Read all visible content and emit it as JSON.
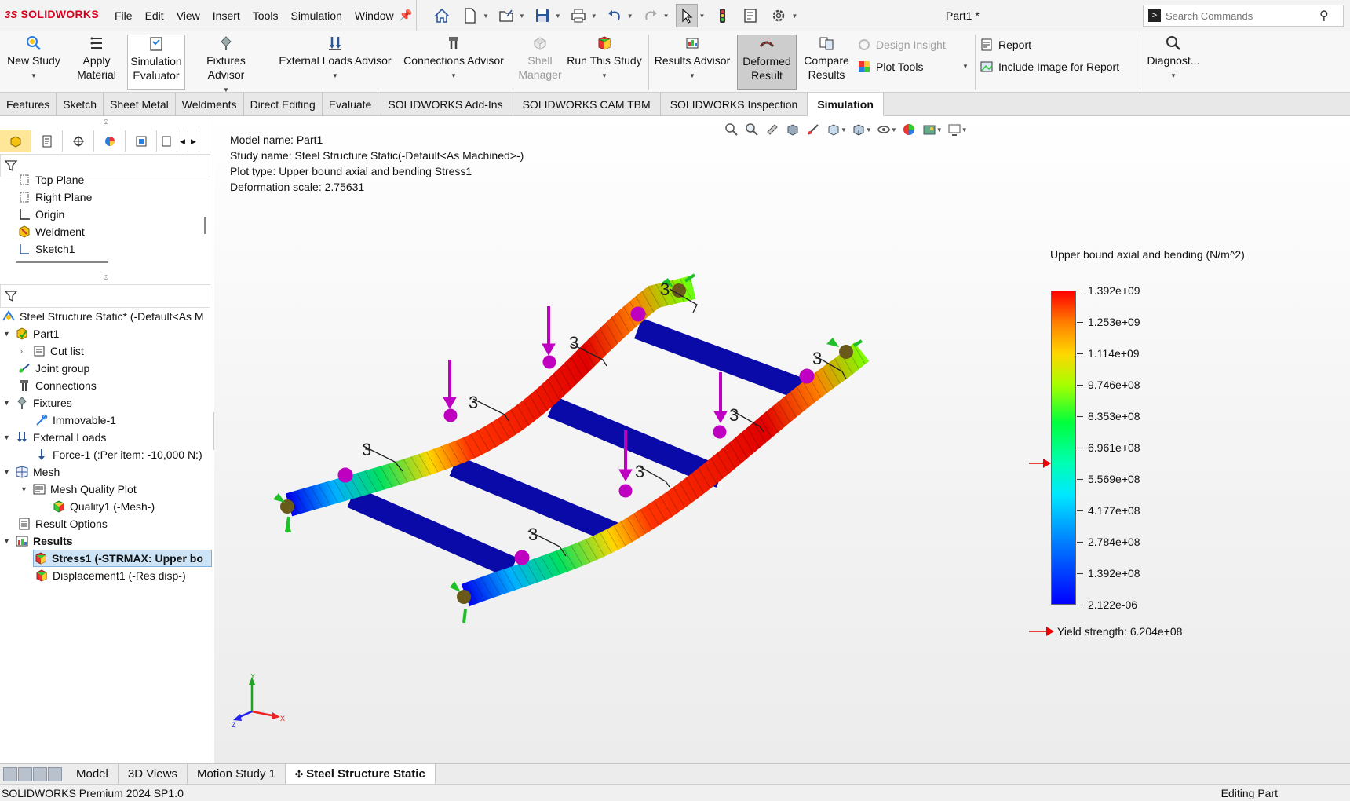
{
  "app": {
    "logo": "SOLIDWORKS",
    "doc_title": "Part1 *"
  },
  "menus": [
    "File",
    "Edit",
    "View",
    "Insert",
    "Tools",
    "Simulation",
    "Window"
  ],
  "quick_icons": [
    "home-icon",
    "new-document-icon",
    "open-icon",
    "save-icon",
    "print-icon",
    "undo-icon",
    "redo-icon",
    "select-icon",
    "traffic-light-icon",
    "file-properties-icon",
    "options-gear-icon"
  ],
  "search": {
    "placeholder": "Search Commands"
  },
  "ribbon": {
    "new_study": "New Study",
    "apply_material_1": "Apply",
    "apply_material_2": "Material",
    "sim_eval_1": "Simulation",
    "sim_eval_2": "Evaluator",
    "fixtures_advisor": "Fixtures Advisor",
    "external_loads_advisor": "External Loads Advisor",
    "connections_advisor": "Connections Advisor",
    "shell_manager_1": "Shell",
    "shell_manager_2": "Manager",
    "run_study": "Run This Study",
    "results_advisor": "Results Advisor",
    "deformed_result_1": "Deformed",
    "deformed_result_2": "Result",
    "compare_results_1": "Compare",
    "compare_results_2": "Results",
    "design_insight": "Design Insight",
    "plot_tools": "Plot Tools",
    "report": "Report",
    "include_image": "Include Image for Report",
    "diagnostics": "Diagnost..."
  },
  "tabs": [
    "Features",
    "Sketch",
    "Sheet Metal",
    "Weldments",
    "Direct Editing",
    "Evaluate",
    "SOLIDWORKS Add-Ins",
    "SOLIDWORKS CAM TBM",
    "SOLIDWORKS Inspection",
    "Simulation"
  ],
  "active_tab": "Simulation",
  "feature_tree": {
    "top_plane": "Top Plane",
    "right_plane": "Right Plane",
    "origin": "Origin",
    "weldment": "Weldment",
    "sketch1": "Sketch1"
  },
  "study_tree": {
    "study": "Steel Structure Static* (-Default<As M",
    "part1": "Part1",
    "cut_list": "Cut list",
    "joint_group": "Joint group",
    "connections": "Connections",
    "fixtures": "Fixtures",
    "immovable": "Immovable-1",
    "external_loads": "External Loads",
    "force1": "Force-1 (:Per item: -10,000 N:)",
    "mesh": "Mesh",
    "mesh_quality_plot": "Mesh Quality Plot",
    "quality1": "Quality1 (-Mesh-)",
    "result_options": "Result Options",
    "results": "Results",
    "stress1": "Stress1 (-STRMAX: Upper bo",
    "displacement1": "Displacement1 (-Res disp-)"
  },
  "plot_info": {
    "model_name": "Model name: Part1",
    "study_name": "Study name: Steel Structure Static(-Default<As Machined>-)",
    "plot_type": "Plot type: Upper bound axial and bending Stress1",
    "deformation_scale": "Deformation scale: 2.75631"
  },
  "legend": {
    "title": "Upper bound axial and bending (N/m^2)",
    "ticks": [
      "1.392e+09",
      "1.253e+09",
      "1.114e+09",
      "9.746e+08",
      "8.353e+08",
      "6.961e+08",
      "5.569e+08",
      "4.177e+08",
      "2.784e+08",
      "1.392e+08",
      "2.122e-06"
    ],
    "yield": "Yield strength: 6.204e+08",
    "colors": {
      "max": "#ff0000",
      "min": "#0000ff"
    }
  },
  "triad": {
    "x": "X",
    "y": "Y",
    "z": "Z"
  },
  "bottom_tabs": [
    "Model",
    "3D Views",
    "Motion Study 1",
    "Steel Structure Static"
  ],
  "status": {
    "left": "SOLIDWORKS Premium 2024 SP1.0",
    "right": "Editing Part"
  }
}
